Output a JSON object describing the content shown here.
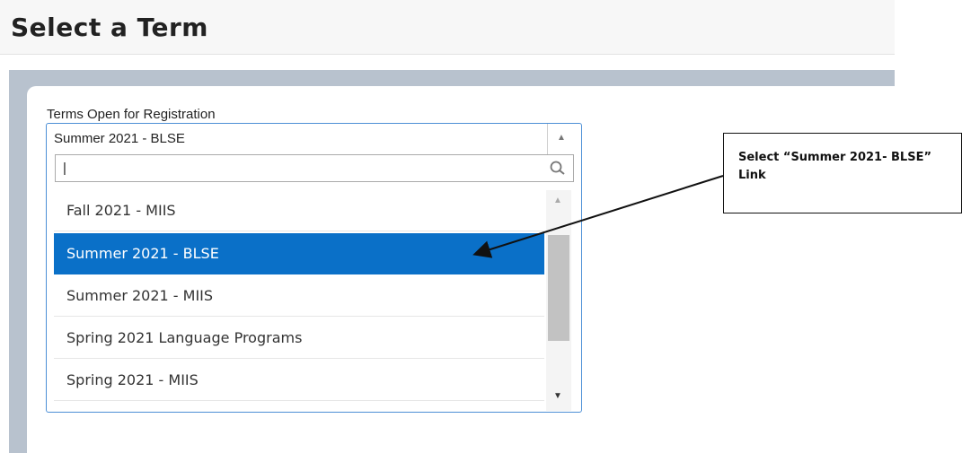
{
  "page": {
    "title": "Select a Term"
  },
  "term_field": {
    "label": "Terms Open for Registration",
    "selected": "Summer 2021 - BLSE",
    "search_placeholder": "|",
    "options": [
      "Fall 2021 - MIIS",
      "Summer 2021 - BLSE",
      "Summer 2021 - MIIS",
      "Spring 2021 Language Programs",
      "Spring 2021 - MIIS"
    ]
  },
  "callout": {
    "text": "Select “Summer 2021- BLSE” Link"
  },
  "icons": {
    "search": "search-icon",
    "arrow_up": "caret-up-icon",
    "arrow_down": "caret-down-icon"
  },
  "colors": {
    "highlight": "#0a70c8",
    "border": "#4c8fd6"
  }
}
